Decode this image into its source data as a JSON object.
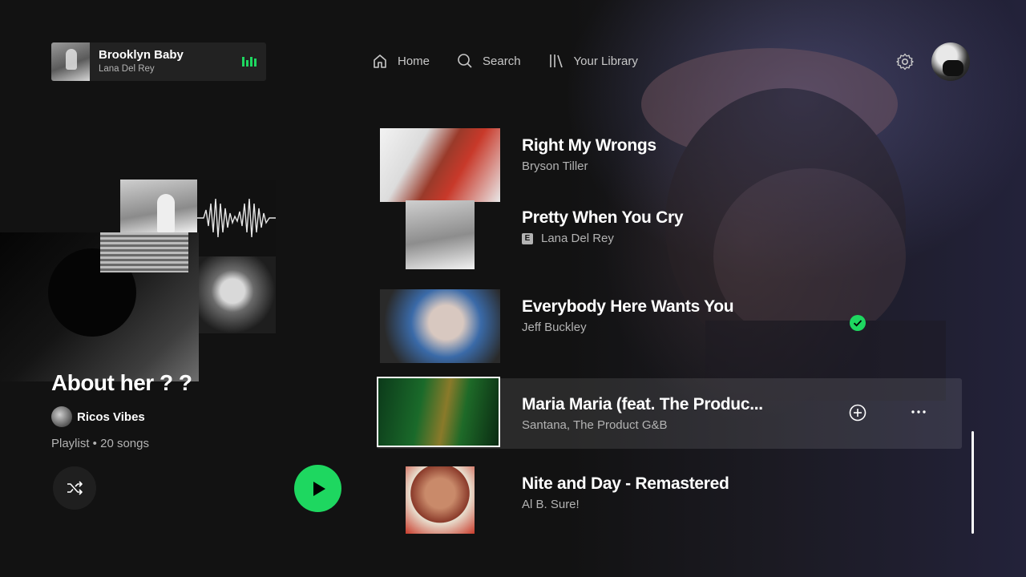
{
  "now_playing": {
    "title": "Brooklyn Baby",
    "artist": "Lana Del Rey"
  },
  "nav": {
    "home": "Home",
    "search": "Search",
    "library": "Your Library"
  },
  "playlist": {
    "title": "About her ? ?",
    "owner": "Ricos Vibes",
    "meta": "Playlist • 20 songs"
  },
  "tracks": [
    {
      "title": "Right My Wrongs",
      "artist": "Bryson Tiller",
      "explicit": false,
      "saved": false,
      "focused": false
    },
    {
      "title": "Pretty When You Cry",
      "artist": "Lana Del Rey",
      "explicit": true,
      "explicit_label": "E",
      "saved": false,
      "focused": false
    },
    {
      "title": "Everybody Here Wants You",
      "artist": "Jeff Buckley",
      "explicit": false,
      "saved": true,
      "focused": false
    },
    {
      "title": "Maria Maria (feat. The Produc...",
      "artist": "Santana, The Product G&B",
      "explicit": false,
      "saved": false,
      "focused": true
    },
    {
      "title": "Nite and Day - Remastered",
      "artist": "Al B. Sure!",
      "explicit": false,
      "saved": false,
      "focused": false
    }
  ],
  "icons": {
    "home": "home-icon",
    "search": "search-icon",
    "library": "library-icon",
    "settings": "gear-icon",
    "shuffle": "shuffle-icon",
    "play": "play-icon",
    "saved": "check-circle-icon",
    "add": "add-circle-icon",
    "more": "more-icon"
  },
  "colors": {
    "accent": "#1ed760",
    "background": "#121212",
    "secondary_text": "#b3b3b3"
  }
}
